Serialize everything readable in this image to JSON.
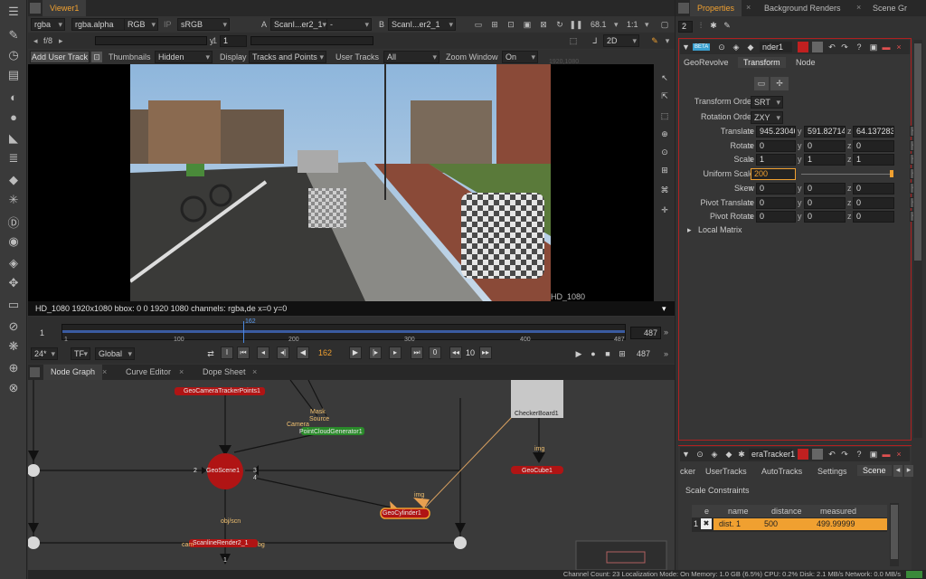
{
  "viewer": {
    "tab": "Viewer1",
    "channels": "rgba",
    "alpha": "rgba.alpha",
    "colorspace": "RGB",
    "ip": "IP",
    "lut": "sRGB",
    "a_label": "A",
    "a_input": "ScanI...er2_1",
    "a_op": "-",
    "b_label": "B",
    "b_input": "ScanI...er2_1",
    "zoom": "68.1",
    "ratio": "1:1",
    "fstop": "f/8",
    "frame_sep": "1",
    "y_label": "y",
    "y_value": "1",
    "mode2d": "2D",
    "add_user_track": "Add User Track",
    "thumbnails_label": "Thumbnails",
    "thumbnails_value": "Hidden",
    "display_label": "Display",
    "display_value": "Tracks and Points",
    "user_tracks_label": "User Tracks",
    "user_tracks_value": "All",
    "zoom_window_label": "Zoom Window",
    "zoom_window_value": "On",
    "format_top": "1920,1080",
    "format_label": "HD_1080",
    "info": "HD_1080 1920x1080  bbox: 0 0 1920 1080 channels: rgba,de  x=0 y=0"
  },
  "timeline": {
    "start": "1",
    "end": "487",
    "end2": "487",
    "ticks": [
      "1",
      "100",
      "200",
      "300",
      "400",
      "487"
    ],
    "current_marker": "162",
    "fps": "24*",
    "tf": "TF",
    "global": "Global",
    "current_frame": "162",
    "step": "10",
    "zero": "0"
  },
  "nodegraph": {
    "tabs": [
      "Node Graph",
      "Curve Editor",
      "Dope Sheet"
    ],
    "nodes": {
      "camera_tracker_points": "GeoCameraTrackerPoints1",
      "mask_label": "Mask",
      "source_label": "Source",
      "camera_label": "Camera",
      "point_cloud": "PointCloudGenerator1",
      "checkerboard": "CheckerBoard1",
      "img1": "img",
      "geoscene": "GeoScene1",
      "geocube": "GeoCube1",
      "port2": "2",
      "port3": "3",
      "port4": "4",
      "geocylinder": "GeoCylinder1",
      "img2": "img",
      "objscn": "obj/scn",
      "scanline": "ScanlineRender2_1",
      "cam": "cam",
      "bg": "bg",
      "port1": "1"
    }
  },
  "status": "Channel Count: 23  Localization Mode: On  Memory: 1.0 GB (6.5%)  CPU: 0.2%  Disk: 2.1 MB/s  Network: 0.0 MB/s",
  "properties": {
    "tabs": [
      "Properties",
      "Background Renders",
      "Scene Gr"
    ],
    "count": "2",
    "node_badge": "BETA",
    "node_name": "nder1",
    "sub_tabs": [
      "GeoRevolve",
      "Transform",
      "Node"
    ],
    "active_sub_tab": "Transform",
    "transform_order_label": "Transform Order",
    "transform_order": "SRT",
    "rotation_order_label": "Rotation Order",
    "rotation_order": "ZXY",
    "fields": [
      {
        "label": "Translate",
        "x": "945.23046",
        "y": "591.82714",
        "z": "64.137283"
      },
      {
        "label": "Rotate",
        "x": "0",
        "y": "0",
        "z": "0"
      },
      {
        "label": "Scale",
        "x": "1",
        "y": "1",
        "z": "1"
      },
      {
        "label": "Skew",
        "x": "0",
        "y": "0",
        "z": "0"
      },
      {
        "label": "Pivot Translate",
        "x": "0",
        "y": "0",
        "z": "0"
      },
      {
        "label": "Pivot Rotate",
        "x": "0",
        "y": "0",
        "z": "0"
      }
    ],
    "uniform_scale_label": "Uniform Scale",
    "uniform_scale": "200",
    "local_matrix": "Local Matrix"
  },
  "tracker": {
    "node_name": "eraTracker1",
    "tabs": [
      "cker",
      "UserTracks",
      "AutoTracks",
      "Settings",
      "Scene"
    ],
    "active_tab": "Scene",
    "section": "Scale Constraints",
    "columns": [
      "e",
      "name",
      "distance",
      "measured"
    ],
    "rows": [
      {
        "index": "1",
        "name": "dist. 1",
        "distance": "500",
        "measured": "499.99999"
      }
    ]
  }
}
